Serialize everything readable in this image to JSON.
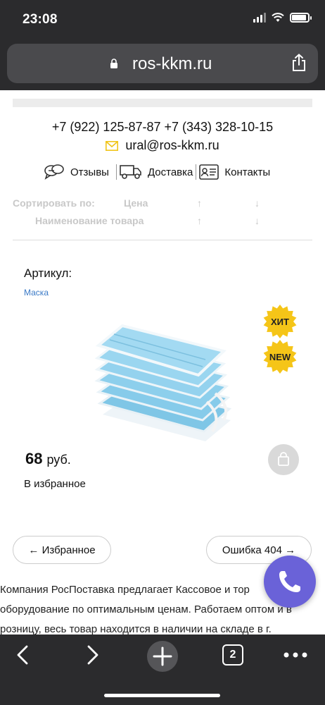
{
  "status_bar": {
    "time": "23:08",
    "battery_level": 0.9
  },
  "url_bar": {
    "url": "ros-kkm.ru"
  },
  "header": {
    "phones": "+7 (922) 125-87-87 +7 (343) 328-10-15",
    "email": "ural@ros-kkm.ru",
    "menu": [
      {
        "label": "Отзывы",
        "icon": "chat-bubbles-icon"
      },
      {
        "label": "Доставка",
        "icon": "truck-icon"
      },
      {
        "label": "Контакты",
        "icon": "contact-card-icon"
      }
    ]
  },
  "sort": {
    "label": "Сортировать по:",
    "price": "Цена",
    "name": "Наименование товара",
    "up": "↑",
    "down": "↓"
  },
  "product": {
    "article_label": "Артикул:",
    "category": "Маска",
    "badges": [
      "ХИТ",
      "NEW"
    ],
    "price": "68",
    "currency": "руб.",
    "favorite": "В избранное"
  },
  "navigation": {
    "prev": "← Избранное",
    "next": "Ошибка 404 →"
  },
  "description": [
    "Компания РосПоставка предлагает Кассовое и тор",
    "оборудование по оптимальным ценам. Работаем оптом и в",
    "розницу, весь товар находится в наличии на складе в г."
  ],
  "toolbar": {
    "tabs_count": "2"
  },
  "colors": {
    "badge": "#f5c518",
    "link": "#3a7ac7",
    "call_button": "#6a62d8",
    "chrome": "#2b2b2d"
  }
}
